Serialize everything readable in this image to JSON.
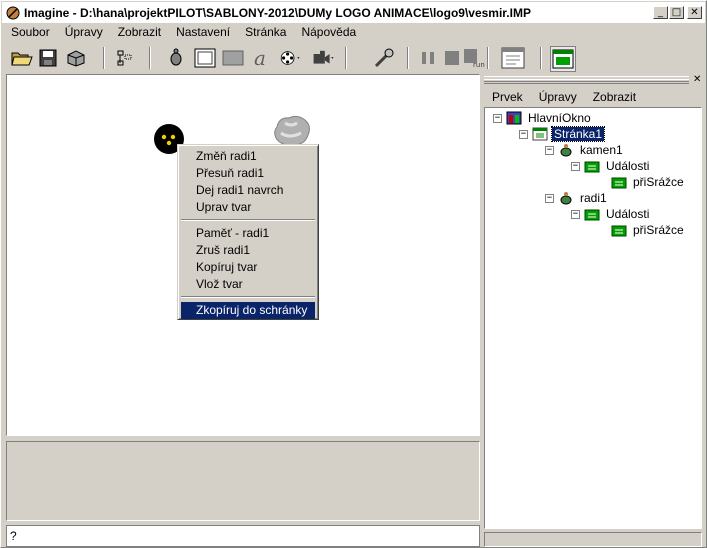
{
  "window": {
    "title": "Imagine - D:\\hana\\projektPILOT\\SABLONY-2012\\DUMy LOGO ANIMACE\\logo9\\vesmir.IMP"
  },
  "menubar": [
    "Soubor",
    "Úpravy",
    "Zobrazit",
    "Nastavení",
    "Stránka",
    "Nápověda"
  ],
  "toolbar": {
    "icons": [
      "open-folder-icon",
      "save-icon",
      "package-icon",
      "tree-view-icon",
      "list-view-icon",
      "turtle-icon",
      "frame-icon",
      "gray-rectangle-icon",
      "text-a-icon",
      "film-reel-icon",
      "camera-icon",
      "pause-icon",
      "stop-icon",
      "run-icon",
      "window-icon",
      "main-window-icon"
    ]
  },
  "context_menu": {
    "items": [
      {
        "label": "Změň radi1"
      },
      {
        "label": "Přesuň radi1"
      },
      {
        "label": "Dej radi1 navrch"
      },
      {
        "label": "Uprav tvar"
      },
      {
        "label": "Paměť - radi1"
      },
      {
        "label": "Zruš radi1"
      },
      {
        "label": "Kopíruj tvar"
      },
      {
        "label": "Vlož tvar"
      },
      {
        "label": "Zkopíruj do schránky",
        "highlighted": true
      }
    ]
  },
  "command_line": {
    "value": "?"
  },
  "right_panel": {
    "menu": [
      "Prvek",
      "Úpravy",
      "Zobrazit"
    ],
    "tree": [
      {
        "label": "HlavníOkno",
        "depth": 0,
        "icon": "main-window-icon",
        "expander": "-"
      },
      {
        "label": "Stránka1",
        "depth": 1,
        "icon": "page-icon",
        "expander": "-",
        "selected": true
      },
      {
        "label": "kamen1",
        "depth": 2,
        "icon": "turtle-icon",
        "expander": "-"
      },
      {
        "label": "Události",
        "depth": 3,
        "icon": "events-icon",
        "expander": "-"
      },
      {
        "label": "přiSrážce",
        "depth": 4,
        "icon": "event-icon",
        "expander": ""
      },
      {
        "label": "radi1",
        "depth": 2,
        "icon": "turtle-icon",
        "expander": "-"
      },
      {
        "label": "Události",
        "depth": 3,
        "icon": "events-icon",
        "expander": "-"
      },
      {
        "label": "přiSrážce",
        "depth": 4,
        "icon": "event-icon",
        "expander": ""
      }
    ]
  },
  "colors": {
    "highlight": "#0a246a",
    "face": "#d4d0c8"
  }
}
